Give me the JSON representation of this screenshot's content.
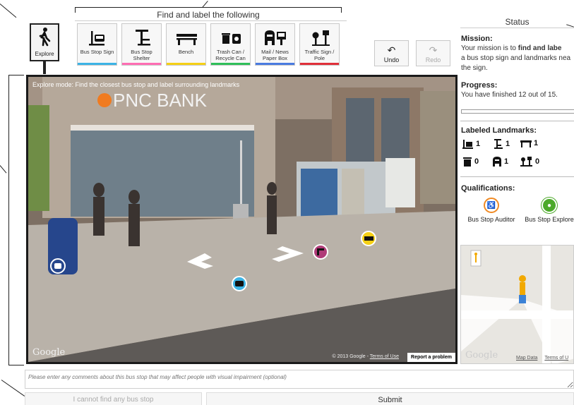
{
  "toolbar": {
    "find_title": "Find and label the following",
    "explore_label": "Explore",
    "tools": [
      {
        "label": "Bus Stop Sign",
        "icon": "bus-stop-sign-icon",
        "color": "#3cb4e6"
      },
      {
        "label": "Bus Stop Shelter",
        "icon": "bus-stop-shelter-icon",
        "color": "#ff6eb4"
      },
      {
        "label": "Bench",
        "icon": "bench-icon",
        "color": "#f5d016"
      },
      {
        "label": "Trash Can / Recycle Can",
        "icon": "trash-can-icon",
        "color": "#2fbf5a"
      },
      {
        "label": "Mail / News Paper Box",
        "icon": "mailbox-icon",
        "color": "#4a7be0"
      },
      {
        "label": "Traffic Sign / Pole",
        "icon": "traffic-sign-icon",
        "color": "#e0303a"
      }
    ],
    "undo_label": "Undo",
    "redo_label": "Redo"
  },
  "streetview": {
    "mode_text": "Explore mode: Find the closest bus stop and label surrounding landmarks",
    "bank_sign": "PNC BANK",
    "google_logo": "Google",
    "footer_text": "© 2013 Google -",
    "terms_text": "Terms of Use",
    "report_text": "Report a problem"
  },
  "status": {
    "title": "Status",
    "mission_heading": "Mission:",
    "mission_line1_pre": "Your mission is to ",
    "mission_line1_bold": "find and labe",
    "mission_line2": "a bus stop sign and landmarks nea",
    "mission_line3": "the sign.",
    "progress_heading": "Progress:",
    "progress_text": "You have finished 12 out of 15.",
    "progress_fraction": 0.8,
    "landmarks_heading": "Labeled Landmarks:",
    "landmarks": [
      {
        "icon": "bus-stop-sign-icon",
        "count": "1"
      },
      {
        "icon": "bus-stop-shelter-icon",
        "count": "1"
      },
      {
        "icon": "bench-icon",
        "count": "1"
      },
      {
        "icon": "trash-can-icon",
        "count": "0"
      },
      {
        "icon": "mailbox-icon",
        "count": "1"
      },
      {
        "icon": "traffic-sign-icon",
        "count": "0"
      }
    ],
    "qualifications_heading": "Qualifications:",
    "qualifications": [
      {
        "label": "Bus Stop Auditor",
        "color": "#f08a24"
      },
      {
        "label": "Bus Stop Explore",
        "color": "#4caa2a"
      }
    ]
  },
  "map": {
    "google_logo": "Google",
    "map_data": "Map Data",
    "terms": "Terms of U"
  },
  "form": {
    "comment_placeholder": "Please enter any comments about this bus stop that may affect people with visual impairment (optional)",
    "cannot_find_label": "I cannot find any bus stop",
    "submit_label": "Submit"
  }
}
